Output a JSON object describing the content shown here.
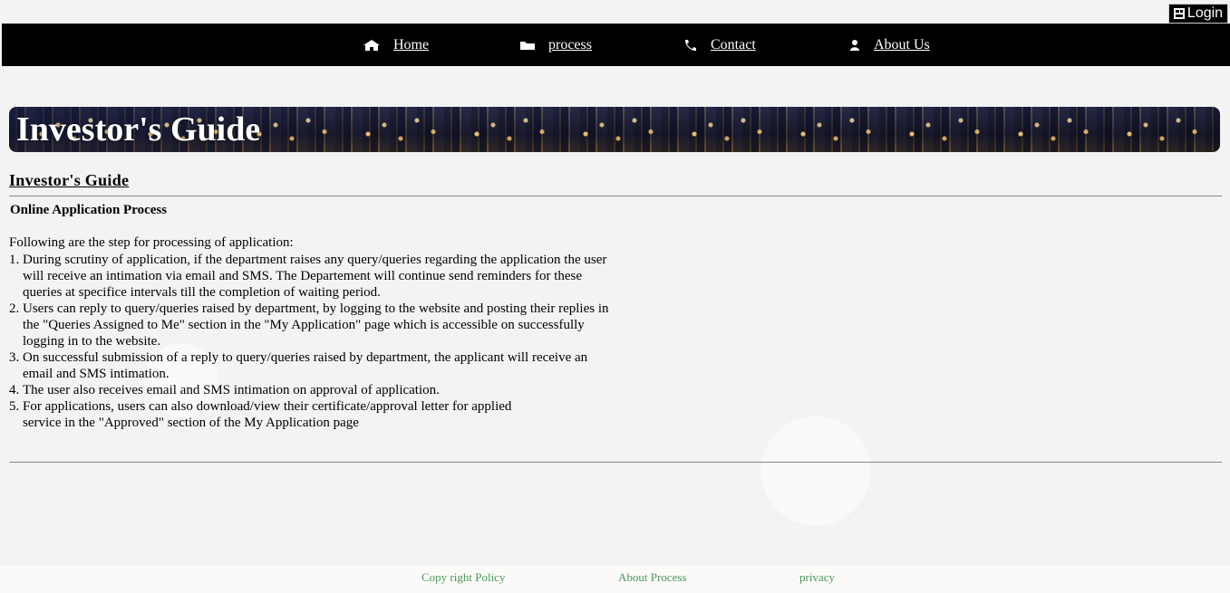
{
  "header": {
    "login_label": "Login",
    "login_icon": "login-icon"
  },
  "nav": {
    "items": [
      {
        "label": "Home",
        "icon": "home-icon"
      },
      {
        "label": "process",
        "icon": "folder-icon"
      },
      {
        "label": "Contact",
        "icon": "phone-icon"
      },
      {
        "label": "About Us",
        "icon": "user-icon"
      }
    ]
  },
  "banner": {
    "title": "Investor's Guide"
  },
  "content": {
    "heading": "Investor's Guide",
    "subheading": "Online Application Process",
    "intro": "Following are the step for processing of application:",
    "steps": [
      {
        "num": "1.",
        "text": "During scrutiny of application, if the department raises any query/queries regarding the application the user\nwill receive an intimation via email and SMS. The Departement will continue send reminders for these\nqueries at specifice intervals till the completion of waiting period."
      },
      {
        "num": "2.",
        "text": "Users can reply to query/queries raised by department, by logging to the website and posting their replies in\nthe \"Queries Assigned to Me\" section in the \"My Application\" page which is accessible on successfully\nlogging  in to the website."
      },
      {
        "num": "3.",
        "text": "On successful submission of a reply to query/queries raised by department, the applicant will receive an\n email and SMS  intimation."
      },
      {
        "num": "4.",
        "text": "The user also receives email and SMS intimation on approval of application."
      },
      {
        "num": "5.",
        "text": "For applications, users can also download/view their certificate/approval letter for applied\nservice in the \"Approved\" section of the My Application page"
      }
    ]
  },
  "footer": {
    "links": [
      "Copy right Policy",
      "About Process",
      "privacy"
    ],
    "link_color": "#4a9a5a"
  }
}
